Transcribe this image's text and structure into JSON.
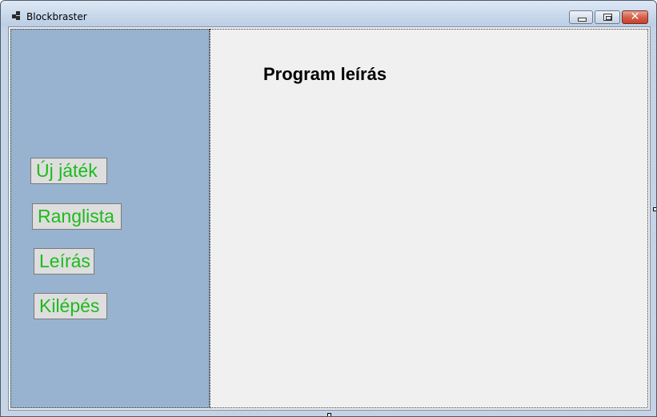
{
  "window": {
    "title": "Blockbraster",
    "close_glyph": "✕"
  },
  "sidebar": {
    "buttons": [
      {
        "label": "Új játék"
      },
      {
        "label": "Ranglista"
      },
      {
        "label": "Leírás"
      },
      {
        "label": "Kilépés"
      }
    ]
  },
  "main": {
    "title": "Program leírás"
  },
  "colors": {
    "sidebar_bg": "#98b3d0",
    "button_text": "#1dbb1d",
    "panel_bg": "#f0f0f0"
  },
  "icons": {
    "app": "app-icon",
    "minimize": "minimize-icon",
    "maximize": "maximize-icon",
    "close": "close-icon"
  }
}
